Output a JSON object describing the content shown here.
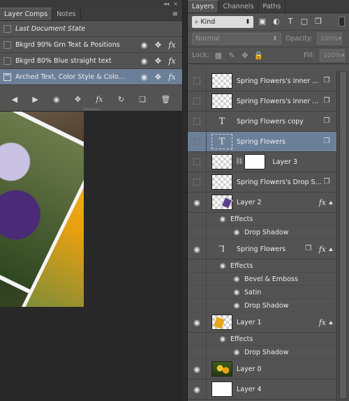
{
  "comps_panel": {
    "tabs": [
      "Layer Comps",
      "Notes"
    ],
    "menu_icon": "panel-menu-icon",
    "strip_arrows": "◂◂",
    "strip_close": "×",
    "comps": [
      {
        "label": "Last Document State",
        "italic": true,
        "selected": false,
        "show_icons": false
      },
      {
        "label": "Bkgrd 90% Grn Text & Positions",
        "italic": false,
        "selected": false,
        "show_icons": true
      },
      {
        "label": "Bkgrd 80% Blue straight text",
        "italic": false,
        "selected": false,
        "show_icons": true
      },
      {
        "label": "Arched Text, Color Style & Colo...",
        "italic": false,
        "selected": true,
        "show_icons": true
      }
    ],
    "footer_icons": [
      "prev-comp-icon",
      "next-comp-icon",
      "update-visibility-icon",
      "update-position-icon",
      "update-appearance-icon",
      "update-comp-icon",
      "new-comp-icon",
      "delete-comp-icon"
    ]
  },
  "layers_panel": {
    "tabs": [
      "Layers",
      "Channels",
      "Paths"
    ],
    "kind_filter": "Kind",
    "blend_mode": "Normal",
    "opacity_label": "Opacity:",
    "opacity_value": "100%",
    "lock_label": "Lock:",
    "fill_label": "Fill:",
    "fill_value": "100%",
    "filter_icons": [
      "image-filter-icon",
      "adjustment-filter-icon",
      "type-filter-icon",
      "shape-filter-icon",
      "smart-object-filter-icon"
    ],
    "layers": [
      {
        "name": "Spring Flowers's Inner ...",
        "thumb": "checker",
        "visible": false,
        "badge": "smart-object-icon",
        "selected": false
      },
      {
        "name": "Spring Flowers's Inner ...",
        "thumb": "checker",
        "visible": false,
        "badge": "smart-object-icon",
        "selected": false
      },
      {
        "name": "Spring Flowers copy",
        "thumb": "text",
        "visible": false,
        "badge": "smart-object-icon",
        "selected": false
      },
      {
        "name": "Spring Flowers",
        "thumb": "text-selected",
        "visible": false,
        "badge": "smart-object-icon",
        "selected": true
      },
      {
        "name": "Layer 3",
        "thumb": "checker-mask",
        "visible": false,
        "badge": "",
        "selected": false
      },
      {
        "name": "Spring Flowers's Drop S...",
        "thumb": "checker",
        "visible": false,
        "badge": "smart-object-icon",
        "selected": false
      },
      {
        "name": "Layer 2",
        "thumb": "layer2",
        "visible": true,
        "badge": "fx",
        "selected": false,
        "effects_heading": "Effects",
        "effects": [
          "Drop Shadow"
        ]
      },
      {
        "name": "Spring Flowers",
        "thumb": "warp",
        "visible": true,
        "badge": "fx-smart",
        "selected": false,
        "effects_heading": "Effects",
        "effects": [
          "Bevel & Emboss",
          "Satin",
          "Drop Shadow"
        ]
      },
      {
        "name": "Layer 1",
        "thumb": "layer1",
        "visible": true,
        "badge": "fx",
        "selected": false,
        "effects_heading": "Effects",
        "effects": [
          "Drop Shadow"
        ]
      },
      {
        "name": "Layer 0",
        "thumb": "flowers",
        "visible": true,
        "badge": "",
        "selected": false
      },
      {
        "name": "Layer 4",
        "thumb": "white",
        "visible": true,
        "badge": "",
        "selected": false
      }
    ]
  },
  "glyphs": {
    "eye": "👁",
    "eye_alt": "◉",
    "move": "✥",
    "fx": "fx",
    "text_T": "T",
    "warp_T": "Ꞁ",
    "search": "⌕",
    "caret": "⬍",
    "chain": "⛓",
    "smart": "❐",
    "prev": "◀",
    "next": "▶",
    "refresh": "↻",
    "new": "❏",
    "trash": "🗑",
    "image": "▣",
    "adjust": "◐",
    "shape": "▢",
    "lock_pixels": "▩",
    "lock_brush": "✎",
    "lock_move": "✥",
    "lock_all": "🔒",
    "menu": "≡"
  }
}
